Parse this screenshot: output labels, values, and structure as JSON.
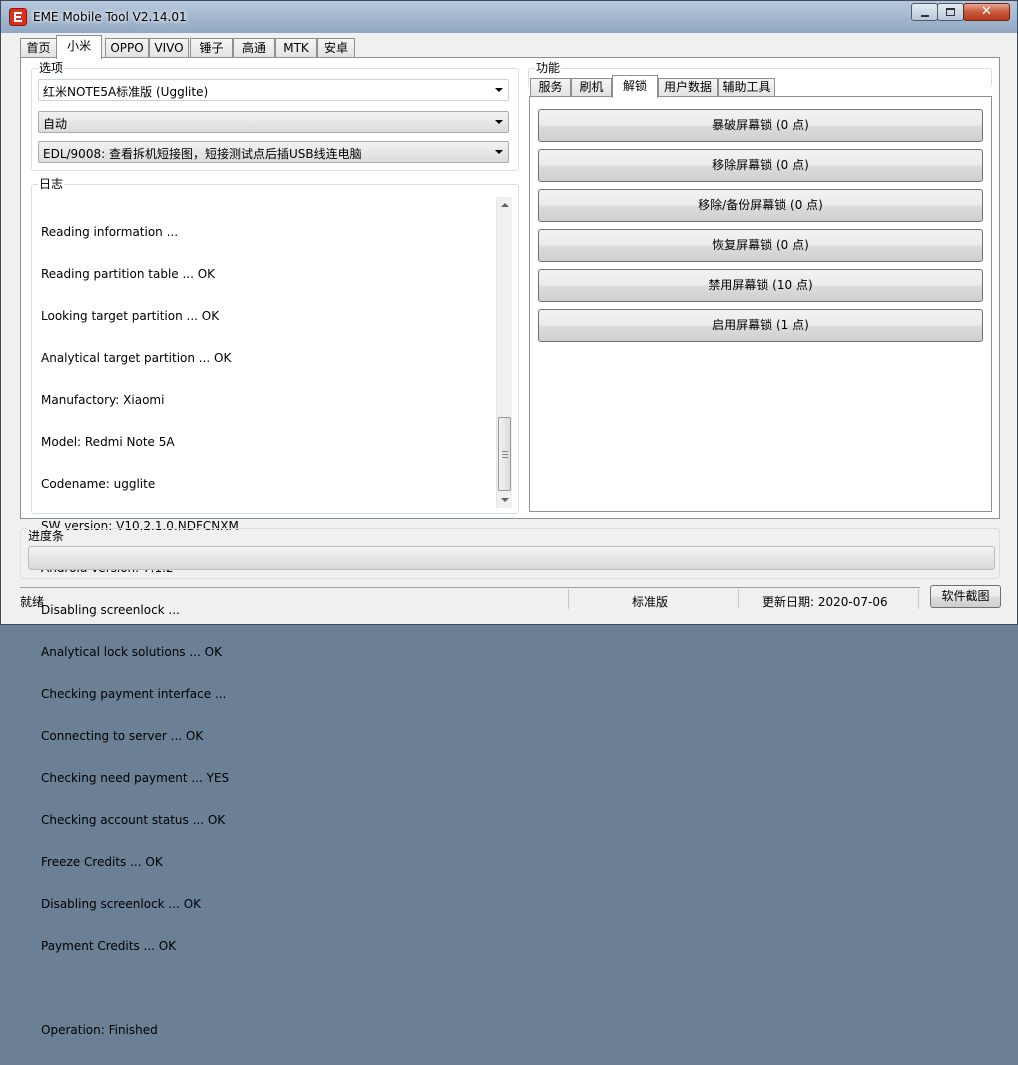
{
  "window": {
    "title": "EME Mobile Tool V2.14.01"
  },
  "main_tabs": [
    "首页",
    "小米",
    "OPPO",
    "VIVO",
    "锤子",
    "高通",
    "MTK",
    "安卓"
  ],
  "options": {
    "label": "选项",
    "device_select": "红米NOTE5A标准版 (Ugglite)",
    "mode_select": "自动",
    "edl_select": "EDL/9008: 查看拆机短接图，短接测试点后插USB线连电脑"
  },
  "log": {
    "label": "日志",
    "lines": [
      "Reading information ...",
      "Reading partition table ... OK",
      "Looking target partition ... OK",
      "Analytical target partition ... OK",
      "Manufactory: Xiaomi",
      "Model: Redmi Note 5A",
      "Codename: ugglite",
      "SW version: V10.2.1.0.NDFCNXM",
      "Android version: 7.1.2",
      "Disabling screenlock ...",
      "Analytical lock solutions ... OK",
      "Checking payment interface ...",
      "Connecting to server ... OK",
      "Checking need payment ... YES",
      "Checking account status ... OK",
      "Freeze Credits ... OK",
      "Disabling screenlock ... OK",
      "Payment Credits ... OK",
      "",
      "Operation: Finished"
    ]
  },
  "functions": {
    "label": "功能",
    "tabs": [
      "服务",
      "刷机",
      "解锁",
      "用户数据",
      "辅助工具"
    ],
    "buttons": [
      "暴破屏幕锁 (0 点)",
      "移除屏幕锁 (0 点)",
      "移除/备份屏幕锁 (0 点)",
      "恢复屏幕锁 (0 点)",
      "禁用屏幕锁 (10 点)",
      "启用屏幕锁 (1 点)"
    ]
  },
  "progress": {
    "label": "进度条",
    "value": 0
  },
  "status": {
    "state": "就绪",
    "edition": "标准版",
    "update_date": "更新日期:  2020-07-06",
    "screenshot_button": "软件截图"
  }
}
